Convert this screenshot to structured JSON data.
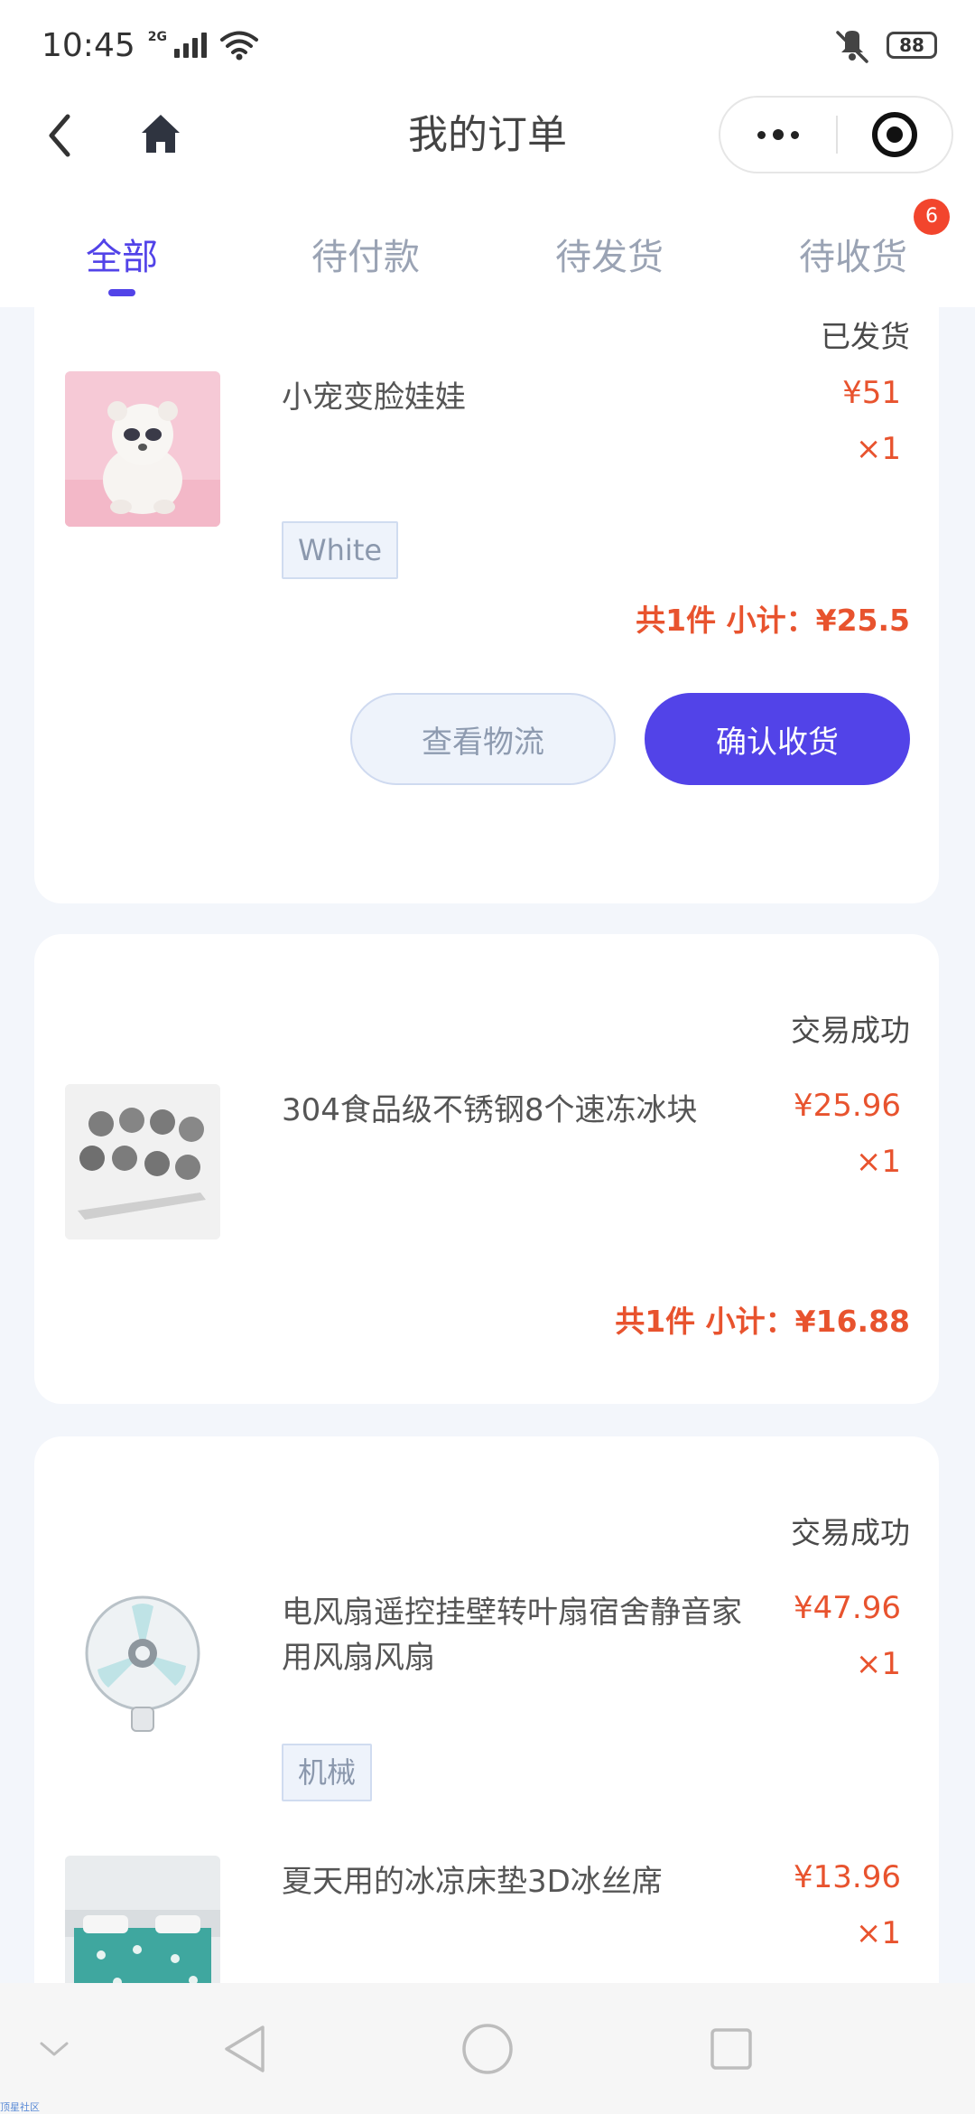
{
  "status_bar": {
    "time": "10:45",
    "network": "2G",
    "battery": "88"
  },
  "nav": {
    "title": "我的订单"
  },
  "tabs": [
    {
      "label": "全部",
      "active": true
    },
    {
      "label": "待付款",
      "active": false
    },
    {
      "label": "待发货",
      "active": false
    },
    {
      "label": "待收货",
      "active": false,
      "badge": "6"
    }
  ],
  "orders": [
    {
      "status": "已发货",
      "items": [
        {
          "name": "小宠变脸娃娃",
          "price": "¥51",
          "qty": "×1",
          "sku": "White"
        }
      ],
      "subtotal": "共1件 小计：¥25.5",
      "buttons": {
        "logistics": "查看物流",
        "confirm": "确认收货"
      }
    },
    {
      "status": "交易成功",
      "items": [
        {
          "name": "304食品级不锈钢8个速冻冰块",
          "price": "¥25.96",
          "qty": "×1"
        }
      ],
      "subtotal": "共1件 小计：¥16.88"
    },
    {
      "status": "交易成功",
      "items": [
        {
          "name": "电风扇遥控挂壁转叶扇宿舍静音家用风扇风扇",
          "price": "¥47.96",
          "qty": "×1",
          "sku": "机械"
        },
        {
          "name": "夏天用的冰凉床垫3D冰丝席",
          "price": "¥13.96",
          "qty": "×1"
        }
      ]
    }
  ],
  "watermark": "顶星社区",
  "colors": {
    "accent": "#5243e8",
    "price": "#e8532e",
    "badge": "#f2452d"
  }
}
